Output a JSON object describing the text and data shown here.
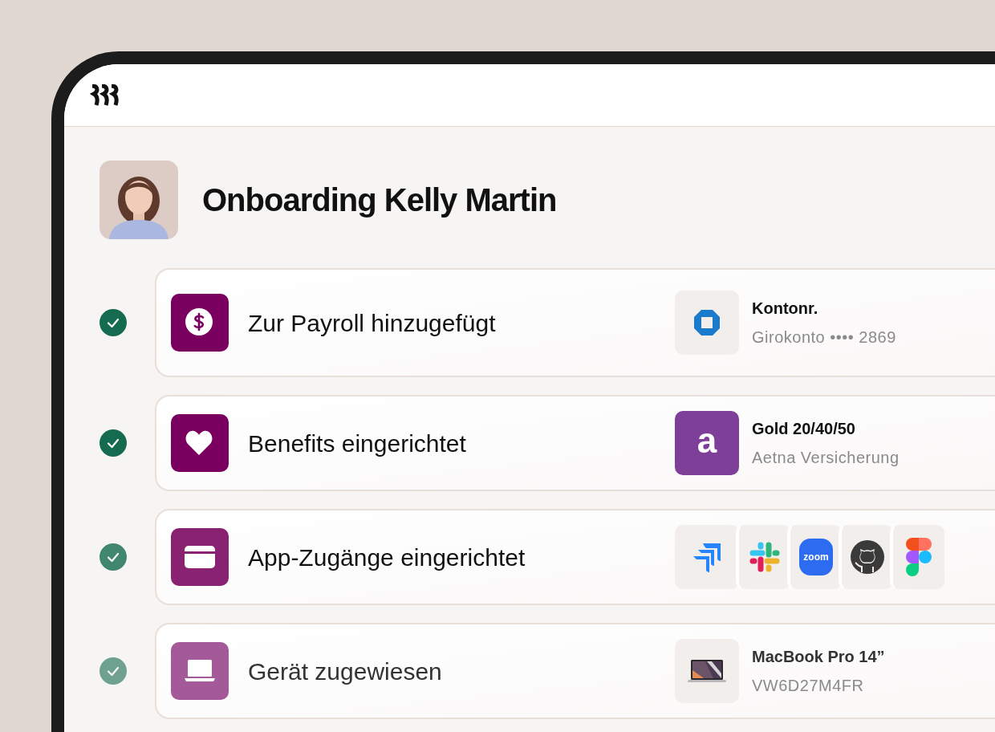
{
  "title": "Onboarding Kelly Martin",
  "tasks": [
    {
      "label": "Zur Payroll hinzugefügt",
      "checked": true,
      "kind": "dollar",
      "color": "#7a0060",
      "detail": {
        "kind": "account",
        "title": "Kontonr.",
        "subtitle": "Girokonto •••• 2869"
      }
    },
    {
      "label": "Benefits eingerichtet",
      "checked": true,
      "kind": "heart",
      "color": "#7a0060",
      "detail": {
        "kind": "plan",
        "logo_letter": "a",
        "title": "Gold 20/40/50",
        "subtitle": "Aetna Versicherung"
      }
    },
    {
      "label": "App-Zugänge eingerichtet",
      "checked": true,
      "kind": "card",
      "color": "#8a2272",
      "detail": {
        "kind": "apps",
        "apps": [
          {
            "kind": "jira"
          },
          {
            "kind": "slack"
          },
          {
            "kind": "zoom",
            "label": "zoom"
          },
          {
            "kind": "github"
          },
          {
            "kind": "figma"
          }
        ]
      }
    },
    {
      "label": "Gerät zugewiesen",
      "checked": true,
      "kind": "laptop",
      "color": "#a45a98",
      "detail": {
        "kind": "device",
        "title": "MacBook Pro 14”",
        "subtitle": "VW6D27M4FR"
      }
    }
  ]
}
